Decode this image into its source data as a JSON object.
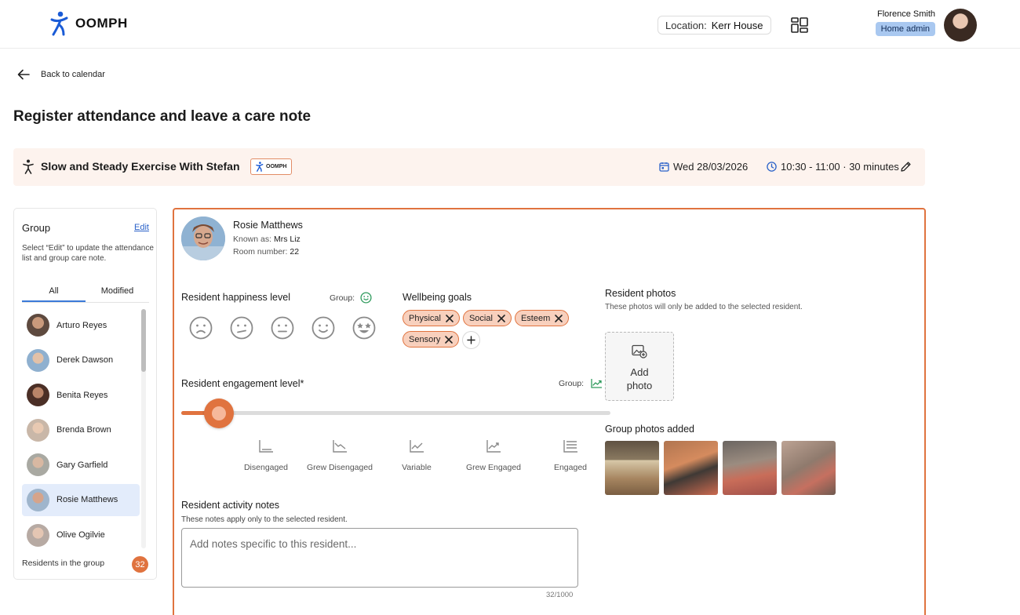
{
  "header": {
    "brand": "OOMPH",
    "location_label": "Location:",
    "location_value": "Kerr House",
    "user_name": "Florence Smith",
    "user_role": "Home admin"
  },
  "nav": {
    "back_label": "Back to calendar"
  },
  "page": {
    "title": "Register attendance and leave a care note"
  },
  "session": {
    "title": "Slow and Steady Exercise With Stefan",
    "badge": "OOMPH",
    "date": "Wed 28/03/2026",
    "time": "10:30 - 11:00 · 30 minutes"
  },
  "group": {
    "title": "Group",
    "edit_label": "Edit",
    "hint": "Select “Edit” to update the attendance list and group care note.",
    "tabs": [
      "All",
      "Modified"
    ],
    "residents": [
      "Arturo Reyes",
      "Derek Dawson",
      "Benita Reyes",
      "Brenda Brown",
      "Gary Garfield",
      "Rosie Matthews",
      "Olive Ogilvie"
    ],
    "selected_resident": "Rosie Matthews",
    "footer_label": "Residents in the group",
    "count": "32"
  },
  "resident": {
    "name": "Rosie Matthews",
    "known_as_label": "Known as:",
    "known_as": "Mrs Liz",
    "room_label": "Room number:",
    "room": "22"
  },
  "happiness": {
    "title": "Resident happiness level",
    "group_label": "Group:",
    "faces": [
      "very-sad-face-icon",
      "sad-face-icon",
      "neutral-face-icon",
      "happy-face-icon",
      "star-eyes-face-icon"
    ]
  },
  "wellbeing": {
    "title": "Wellbeing goals",
    "goals": [
      "Physical",
      "Social",
      "Esteem",
      "Sensory"
    ]
  },
  "engagement": {
    "title": "Resident engagement level*",
    "group_label": "Group:",
    "slider_value": 0.06,
    "levels": [
      "Disengaged",
      "Grew Disengaged",
      "Variable",
      "Grew Engaged",
      "Engaged"
    ]
  },
  "notes": {
    "title": "Resident activity notes",
    "hint": "These notes apply only to the selected resident.",
    "placeholder": "Add notes specific to this resident...",
    "counter": "32/1000"
  },
  "photos": {
    "title": "Resident photos",
    "hint": "These photos will only be added to the selected resident.",
    "add_label_line1": "Add",
    "add_label_line2": "photo",
    "group_title": "Group photos added"
  },
  "colors": {
    "accent": "#e0733f",
    "chip_bg": "#f8d0bd",
    "session_bg": "#fdf3ee",
    "selected_row": "#e3ecfb",
    "role_badge": "#a9c8f0",
    "link": "#2a62c9"
  }
}
